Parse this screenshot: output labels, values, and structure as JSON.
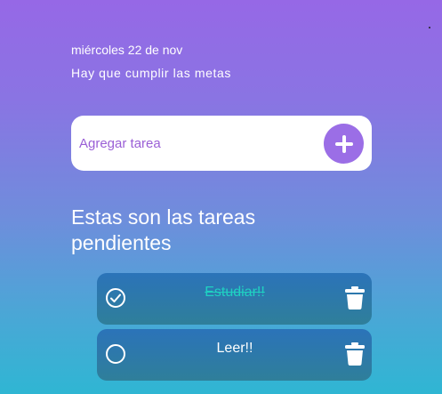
{
  "header": {
    "date": "miércoles 22 de nov",
    "motto": "Hay que cumplir las metas"
  },
  "add_task": {
    "placeholder": "Agregar tarea",
    "value": "",
    "button_icon": "plus-icon"
  },
  "tasks_section": {
    "title": "Estas son las tareas pendientes"
  },
  "tasks": [
    {
      "label": "Estudiar!!",
      "completed": true,
      "check_icon": "check-circle-icon",
      "delete_icon": "trash-icon"
    },
    {
      "label": "Leer!!",
      "completed": false,
      "check_icon": "circle-icon",
      "delete_icon": "trash-icon"
    }
  ],
  "colors": {
    "accent": "#9b6ee6",
    "placeholder": "#9a5fd6",
    "done_text": "#1fd1c2",
    "task_bg_top": "#2b73b9",
    "task_bg_bottom": "#2f7f9a"
  }
}
